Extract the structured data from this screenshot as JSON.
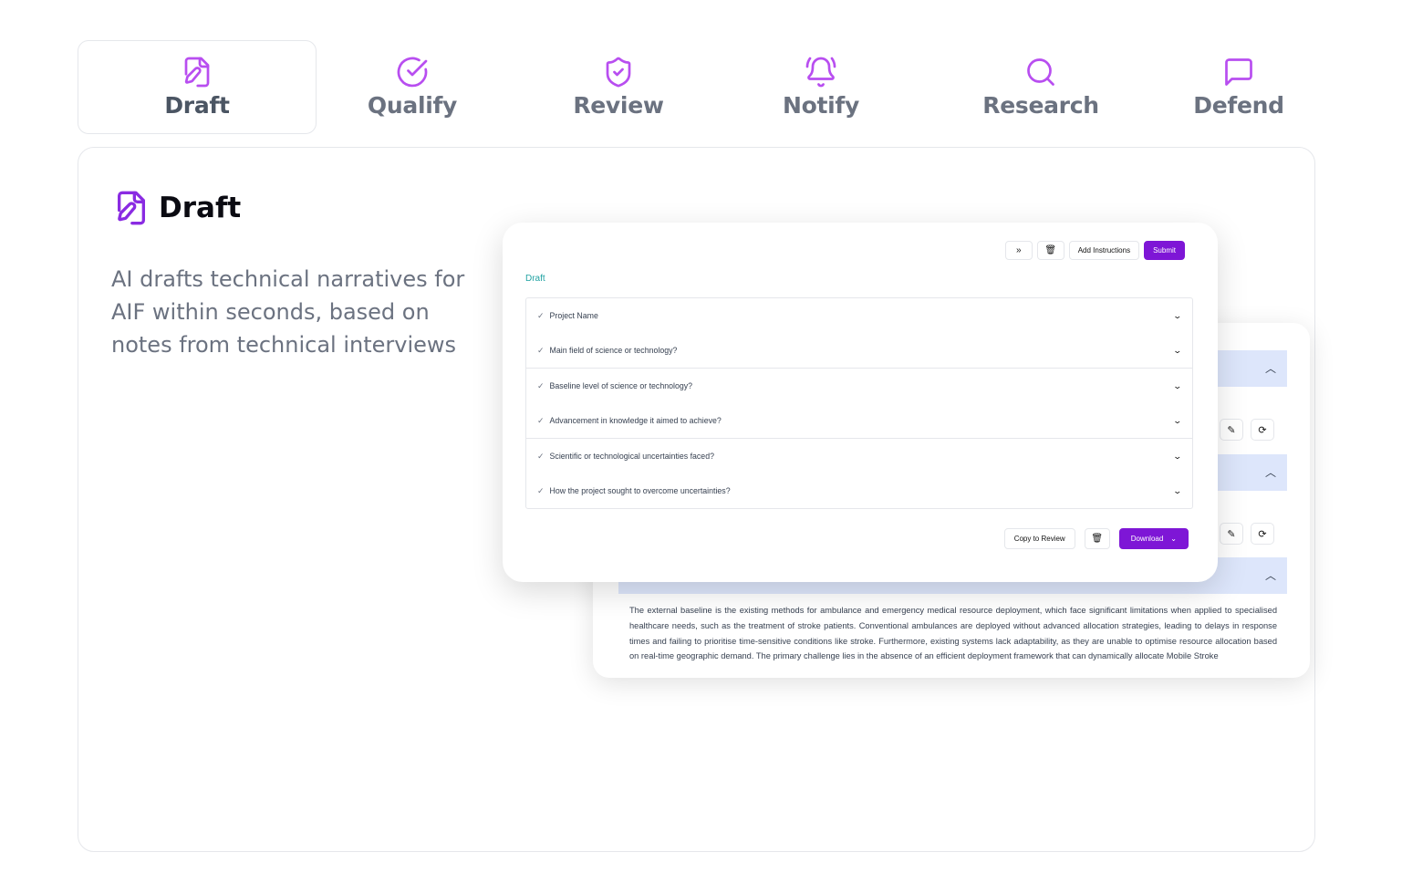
{
  "tabs": [
    {
      "label": "Draft",
      "icon": "file-pen-icon",
      "active": true
    },
    {
      "label": "Qualify",
      "icon": "check-circle-icon",
      "active": false
    },
    {
      "label": "Review",
      "icon": "shield-check-icon",
      "active": false
    },
    {
      "label": "Notify",
      "icon": "bell-ring-icon",
      "active": false
    },
    {
      "label": "Research",
      "icon": "search-icon",
      "active": false
    },
    {
      "label": "Defend",
      "icon": "message-square-icon",
      "active": false
    }
  ],
  "main": {
    "title": "Draft",
    "description": "AI drafts technical narratives for AIF within seconds, based on notes from technical interviews"
  },
  "front_panel": {
    "toolbar": {
      "add_instructions": "Add Instructions",
      "submit": "Submit"
    },
    "section_label": "Draft",
    "questions": [
      "Project Name",
      "Main field of science or technology?",
      "Baseline level of science or technology?",
      "Advancement in knowledge it aimed to achieve?",
      "Scientific or technological uncertainties faced?",
      "How the project sought to overcome uncertainties?"
    ],
    "footer": {
      "copy_to_review": "Copy to Review",
      "download": "Download"
    }
  },
  "back_panel": {
    "paragraph": "The external baseline is the existing methods for ambulance and emergency medical resource deployment, which face significant limitations when applied to specialised healthcare needs, such as the treatment of stroke patients. Conventional ambulances are deployed without advanced allocation strategies, leading to delays in response times and failing to prioritise time-sensitive conditions like stroke. Furthermore, existing systems lack adaptability, as they are unable to optimise resource allocation based on real-time geographic demand. The primary challenge lies in the absence of an efficient deployment framework that can dynamically allocate Mobile Stroke"
  },
  "colors": {
    "accent": "#7e16d6",
    "icon_purple": "#b84ef0",
    "band_blue": "#dde6fb",
    "link_teal": "#22a3a3"
  }
}
